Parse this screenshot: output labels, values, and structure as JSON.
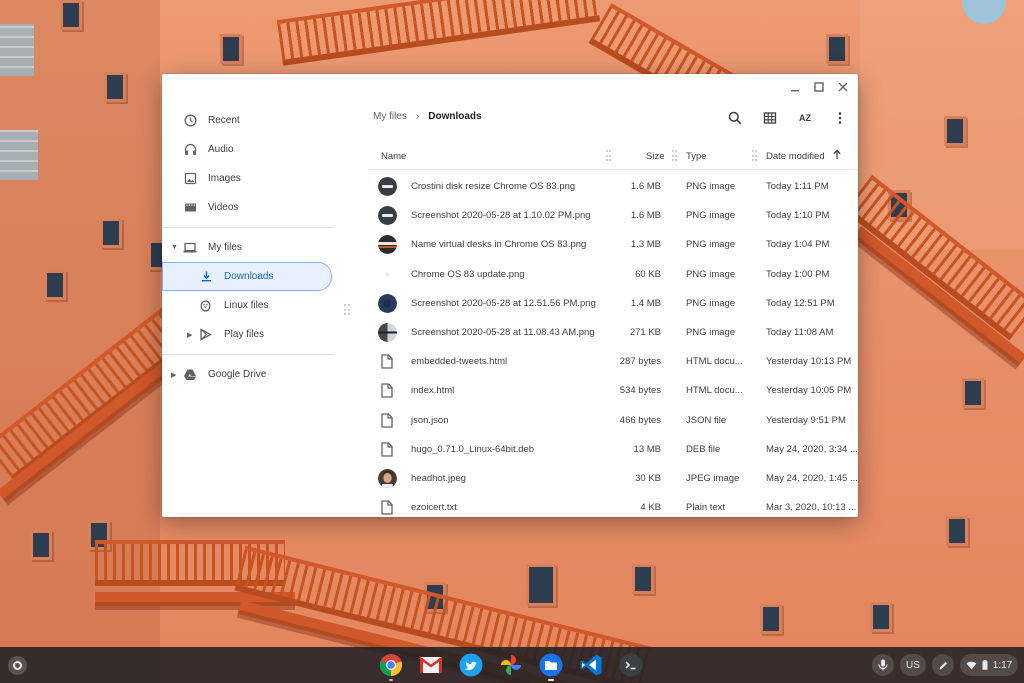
{
  "window": {
    "breadcrumb": {
      "root": "My files",
      "current": "Downloads"
    }
  },
  "sidebar": {
    "items": [
      {
        "label": "Recent",
        "icon": "clock-icon"
      },
      {
        "label": "Audio",
        "icon": "headphones-icon"
      },
      {
        "label": "Images",
        "icon": "image-icon"
      },
      {
        "label": "Videos",
        "icon": "video-icon"
      },
      {
        "label": "My files",
        "icon": "laptop-icon"
      },
      {
        "label": "Downloads",
        "icon": "download-icon",
        "selected": true
      },
      {
        "label": "Linux files",
        "icon": "penguin-icon"
      },
      {
        "label": "Play files",
        "icon": "play-store-icon"
      },
      {
        "label": "Google Drive",
        "icon": "google-drive-icon"
      }
    ]
  },
  "table": {
    "columns": {
      "name": "Name",
      "size": "Size",
      "type": "Type",
      "date": "Date modified"
    },
    "sort": {
      "column": "Date modified",
      "direction": "ascending-arrow"
    },
    "rows": [
      {
        "name": "Crostini disk resize Chrome OS 83.png",
        "size": "1.6 MB",
        "type": "PNG image",
        "date": "Today 1:11 PM",
        "thumb": "dark-circle"
      },
      {
        "name": "Screenshot 2020-05-28 at 1.10.02 PM.png",
        "size": "1.6 MB",
        "type": "PNG image",
        "date": "Today 1:10 PM",
        "thumb": "dark-circle"
      },
      {
        "name": "Name virtual desks in Chrome OS 83.png",
        "size": "1.3 MB",
        "type": "PNG image",
        "date": "Today 1:04 PM",
        "thumb": "stripe-circle"
      },
      {
        "name": "Chrome OS 83 update.png",
        "size": "60 KB",
        "type": "PNG image",
        "date": "Today 1:00 PM",
        "thumb": "light"
      },
      {
        "name": "Screenshot 2020-05-28 at 12.51.56 PM.png",
        "size": "1.4 MB",
        "type": "PNG image",
        "date": "Today 12:51 PM",
        "thumb": "navy-circle"
      },
      {
        "name": "Screenshot 2020-05-28 at 11.08.43 AM.png",
        "size": "271 KB",
        "type": "PNG image",
        "date": "Today 11:08 AM",
        "thumb": "split-circle"
      },
      {
        "name": "embedded-tweets.html",
        "size": "287 bytes",
        "type": "HTML docu...",
        "date": "Yesterday 10:13 PM",
        "thumb": "file"
      },
      {
        "name": "index.html",
        "size": "534 bytes",
        "type": "HTML docu...",
        "date": "Yesterday 10:05 PM",
        "thumb": "file"
      },
      {
        "name": "json.json",
        "size": "466 bytes",
        "type": "JSON file",
        "date": "Yesterday 9:51 PM",
        "thumb": "file"
      },
      {
        "name": "hugo_0.71.0_Linux-64bit.deb",
        "size": "13 MB",
        "type": "DEB file",
        "date": "May 24, 2020, 3:34 ...",
        "thumb": "file"
      },
      {
        "name": "headhot.jpeg",
        "size": "30 KB",
        "type": "JPEG image",
        "date": "May 24, 2020, 1:45 ...",
        "thumb": "face"
      },
      {
        "name": "ezoicert.txt",
        "size": "4 KB",
        "type": "Plain text",
        "date": "Mar 3, 2020, 10:13 ...",
        "thumb": "file"
      }
    ]
  },
  "toolbar": {
    "sort_label": "AZ",
    "icons": [
      "search-icon",
      "grid-view-icon",
      "sort-az-icon",
      "more-vert-icon"
    ]
  },
  "shelf": {
    "apps": [
      "chrome-icon",
      "gmail-icon",
      "twitter-icon",
      "photos-icon",
      "files-icon",
      "vscode-icon",
      "terminal-icon"
    ],
    "tray": {
      "ime": "US",
      "time": "1:17"
    }
  },
  "colors": {
    "accent": "#1967d2",
    "selected_bg": "#e8f0fe",
    "wallpaper": "#e8916a"
  }
}
